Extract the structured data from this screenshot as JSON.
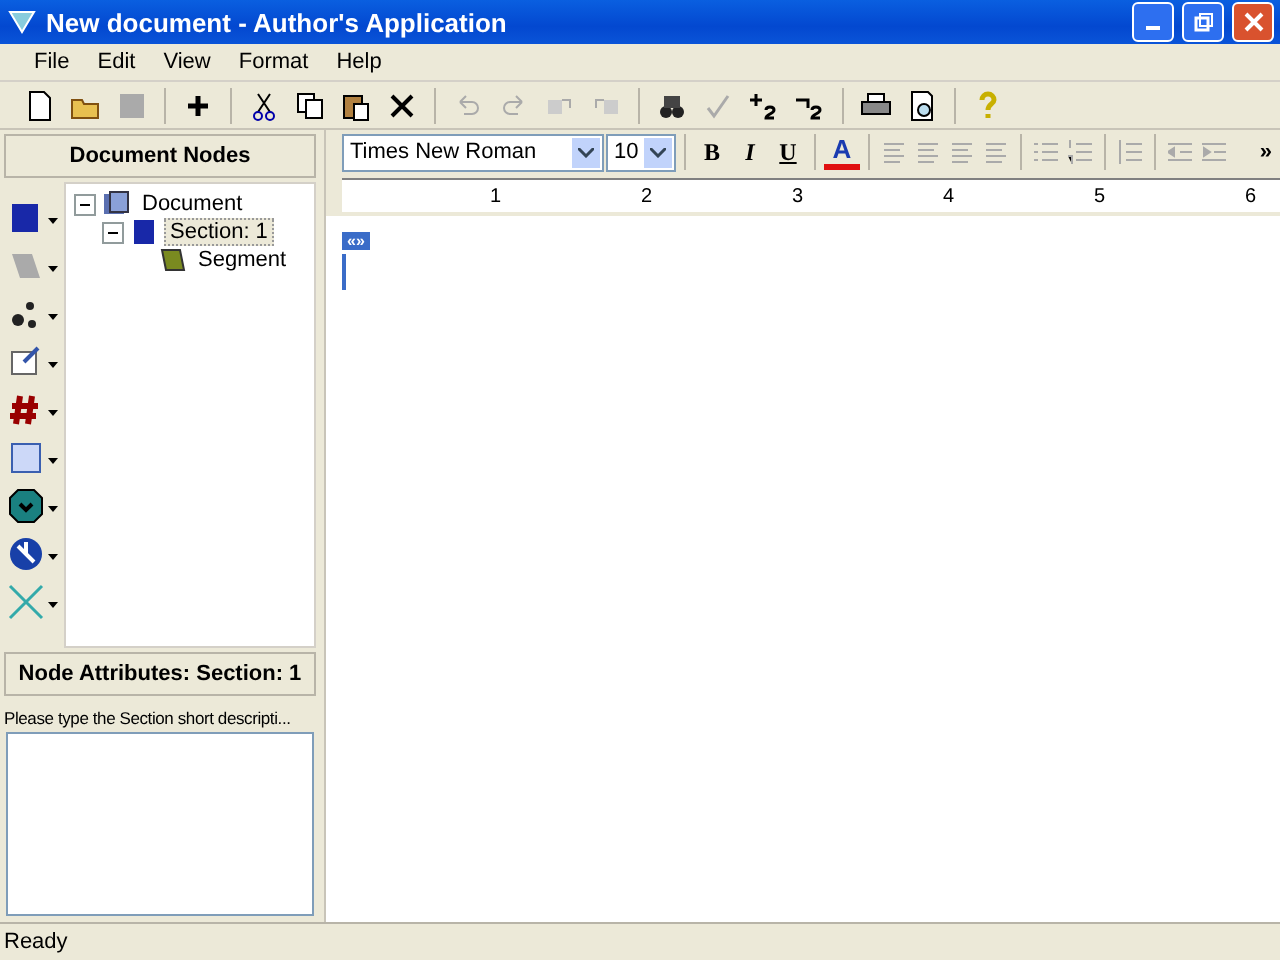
{
  "window": {
    "title": "New document - Author's Application"
  },
  "menu": [
    "File",
    "Edit",
    "View",
    "Format",
    "Help"
  ],
  "nodes_panel": {
    "title": "Document Nodes",
    "tree": [
      {
        "label": "Document",
        "kind": "document",
        "expanded": true,
        "selected": false,
        "children": [
          {
            "label": "Section: 1",
            "kind": "section",
            "expanded": true,
            "selected": true,
            "children": [
              {
                "label": "Segment",
                "kind": "segment",
                "selected": false
              }
            ]
          }
        ]
      }
    ]
  },
  "attributes_panel": {
    "title": "Node Attributes: Section: 1",
    "prompt": "Please type the Section short descripti..."
  },
  "format_bar": {
    "font": "Times New Roman",
    "size": "10",
    "bold": "B",
    "italic": "I",
    "underline": "U",
    "font_color": "A",
    "more": "»"
  },
  "ruler": [
    "1",
    "2",
    "3",
    "4",
    "5",
    "6"
  ],
  "editor": {
    "marker": "«»"
  },
  "status_bar": "Ready"
}
